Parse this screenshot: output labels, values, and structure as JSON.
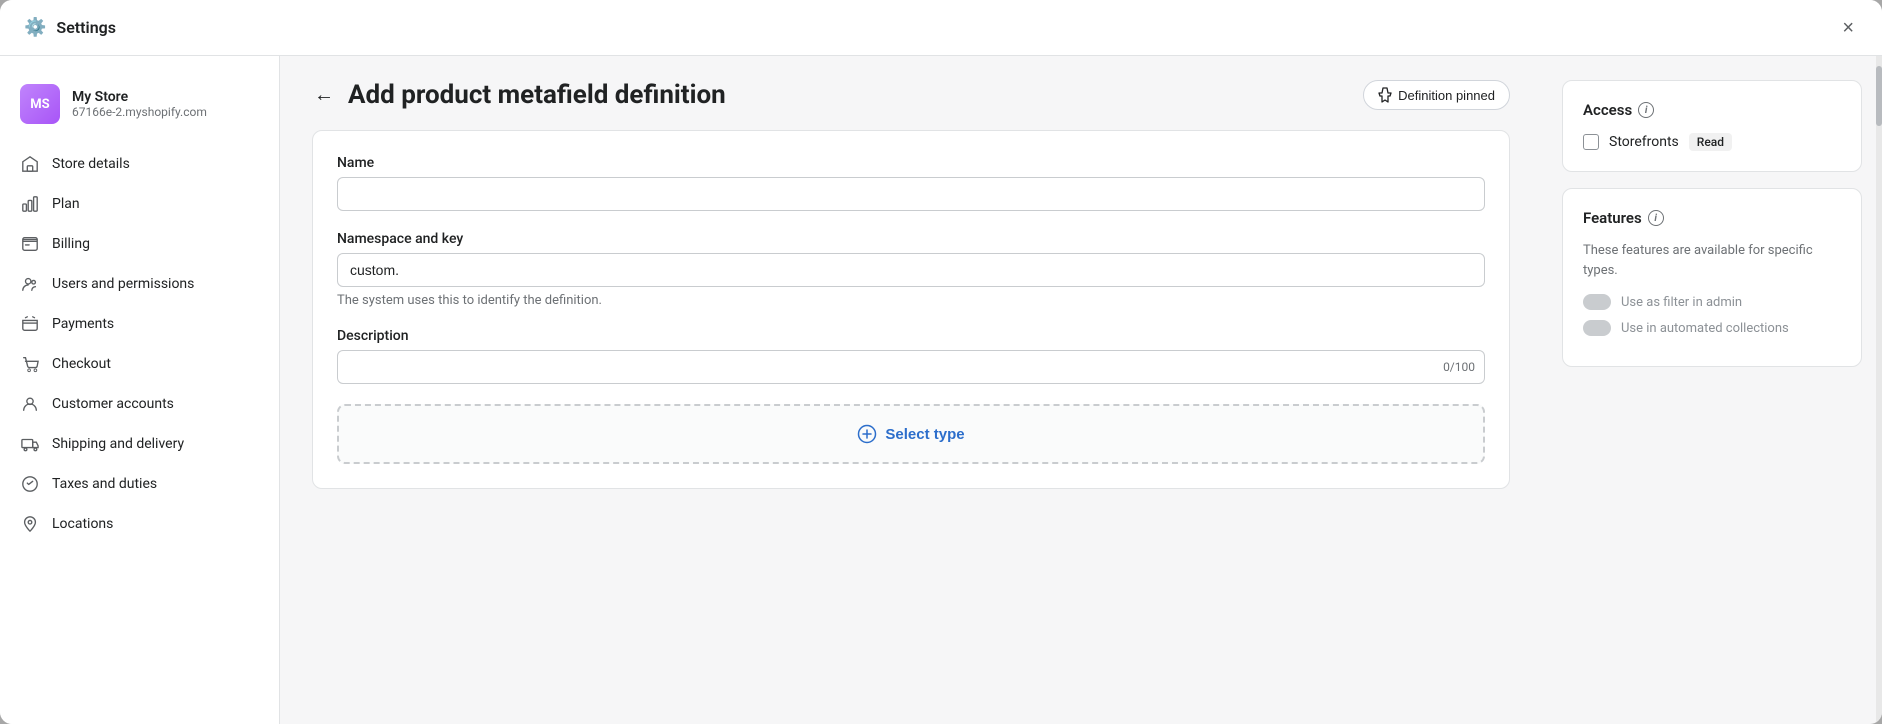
{
  "modal": {
    "title": "Settings",
    "close_label": "×"
  },
  "store": {
    "initials": "MS",
    "name": "My Store",
    "url": "67166e-2.myshopify.com"
  },
  "nav": {
    "items": [
      {
        "id": "store-details",
        "icon": "🏠",
        "label": "Store details"
      },
      {
        "id": "plan",
        "icon": "📊",
        "label": "Plan"
      },
      {
        "id": "billing",
        "icon": "💳",
        "label": "Billing"
      },
      {
        "id": "users-permissions",
        "icon": "👤",
        "label": "Users and permissions"
      },
      {
        "id": "payments",
        "icon": "💳",
        "label": "Payments"
      },
      {
        "id": "checkout",
        "icon": "🛒",
        "label": "Checkout"
      },
      {
        "id": "customer-accounts",
        "icon": "👤",
        "label": "Customer accounts"
      },
      {
        "id": "shipping-delivery",
        "icon": "🚚",
        "label": "Shipping and delivery"
      },
      {
        "id": "taxes-duties",
        "icon": "🏷️",
        "label": "Taxes and duties"
      },
      {
        "id": "locations",
        "icon": "📍",
        "label": "Locations"
      }
    ]
  },
  "page": {
    "title": "Add product metafield definition",
    "back_label": "←",
    "pin_badge_label": "Definition pinned"
  },
  "form": {
    "name_label": "Name",
    "name_placeholder": "",
    "namespace_label": "Namespace and key",
    "namespace_value": "custom.",
    "namespace_hint": "The system uses this to identify the definition.",
    "description_label": "Description",
    "description_placeholder": "",
    "char_count": "0/100",
    "select_type_label": "Select type"
  },
  "access_panel": {
    "title": "Access",
    "storefronts_label": "Storefronts",
    "read_label": "Read"
  },
  "features_panel": {
    "title": "Features",
    "description": "These features are available for specific types.",
    "features": [
      {
        "label": "Use as filter in admin"
      },
      {
        "label": "Use in automated collections"
      }
    ]
  }
}
